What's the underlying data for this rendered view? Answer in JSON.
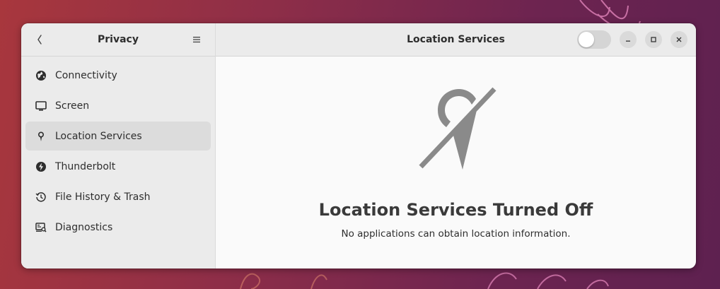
{
  "sidebar": {
    "title": "Privacy",
    "items": [
      {
        "label": "Connectivity",
        "icon": "globe-icon"
      },
      {
        "label": "Screen",
        "icon": "monitor-icon"
      },
      {
        "label": "Location Services",
        "icon": "map-pin-icon",
        "selected": true
      },
      {
        "label": "Thunderbolt",
        "icon": "thunderbolt-icon"
      },
      {
        "label": "File History & Trash",
        "icon": "history-icon"
      },
      {
        "label": "Diagnostics",
        "icon": "diagnostics-icon"
      }
    ]
  },
  "header": {
    "title": "Location Services",
    "toggle_on": false
  },
  "main": {
    "status_title": "Location Services Turned Off",
    "status_description": "No applications can obtain location information."
  },
  "colors": {
    "wallpaper_start": "#a8373d",
    "wallpaper_end": "#5e2150",
    "selected_item_bg": "#dcdcdc",
    "status_icon": "#8a8a8a"
  }
}
